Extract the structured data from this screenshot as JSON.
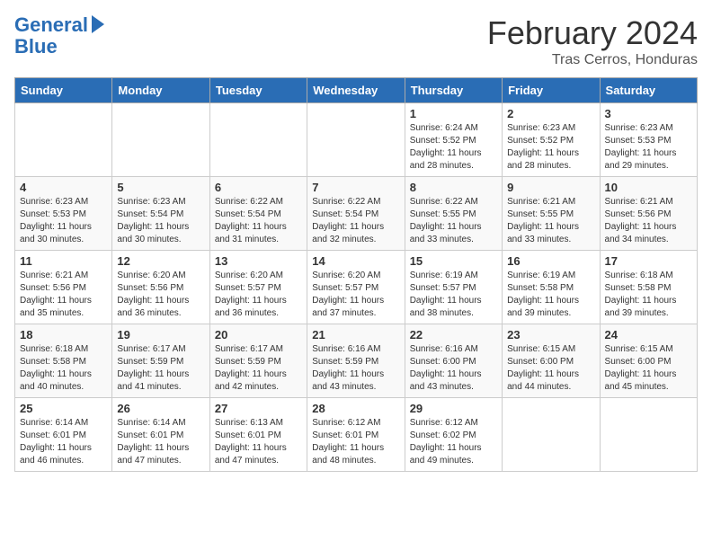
{
  "header": {
    "logo_line1": "General",
    "logo_line2": "Blue",
    "month_year": "February 2024",
    "location": "Tras Cerros, Honduras"
  },
  "days_of_week": [
    "Sunday",
    "Monday",
    "Tuesday",
    "Wednesday",
    "Thursday",
    "Friday",
    "Saturday"
  ],
  "weeks": [
    [
      {
        "day": "",
        "info": ""
      },
      {
        "day": "",
        "info": ""
      },
      {
        "day": "",
        "info": ""
      },
      {
        "day": "",
        "info": ""
      },
      {
        "day": "1",
        "info": "Sunrise: 6:24 AM\nSunset: 5:52 PM\nDaylight: 11 hours\nand 28 minutes."
      },
      {
        "day": "2",
        "info": "Sunrise: 6:23 AM\nSunset: 5:52 PM\nDaylight: 11 hours\nand 28 minutes."
      },
      {
        "day": "3",
        "info": "Sunrise: 6:23 AM\nSunset: 5:53 PM\nDaylight: 11 hours\nand 29 minutes."
      }
    ],
    [
      {
        "day": "4",
        "info": "Sunrise: 6:23 AM\nSunset: 5:53 PM\nDaylight: 11 hours\nand 30 minutes."
      },
      {
        "day": "5",
        "info": "Sunrise: 6:23 AM\nSunset: 5:54 PM\nDaylight: 11 hours\nand 30 minutes."
      },
      {
        "day": "6",
        "info": "Sunrise: 6:22 AM\nSunset: 5:54 PM\nDaylight: 11 hours\nand 31 minutes."
      },
      {
        "day": "7",
        "info": "Sunrise: 6:22 AM\nSunset: 5:54 PM\nDaylight: 11 hours\nand 32 minutes."
      },
      {
        "day": "8",
        "info": "Sunrise: 6:22 AM\nSunset: 5:55 PM\nDaylight: 11 hours\nand 33 minutes."
      },
      {
        "day": "9",
        "info": "Sunrise: 6:21 AM\nSunset: 5:55 PM\nDaylight: 11 hours\nand 33 minutes."
      },
      {
        "day": "10",
        "info": "Sunrise: 6:21 AM\nSunset: 5:56 PM\nDaylight: 11 hours\nand 34 minutes."
      }
    ],
    [
      {
        "day": "11",
        "info": "Sunrise: 6:21 AM\nSunset: 5:56 PM\nDaylight: 11 hours\nand 35 minutes."
      },
      {
        "day": "12",
        "info": "Sunrise: 6:20 AM\nSunset: 5:56 PM\nDaylight: 11 hours\nand 36 minutes."
      },
      {
        "day": "13",
        "info": "Sunrise: 6:20 AM\nSunset: 5:57 PM\nDaylight: 11 hours\nand 36 minutes."
      },
      {
        "day": "14",
        "info": "Sunrise: 6:20 AM\nSunset: 5:57 PM\nDaylight: 11 hours\nand 37 minutes."
      },
      {
        "day": "15",
        "info": "Sunrise: 6:19 AM\nSunset: 5:57 PM\nDaylight: 11 hours\nand 38 minutes."
      },
      {
        "day": "16",
        "info": "Sunrise: 6:19 AM\nSunset: 5:58 PM\nDaylight: 11 hours\nand 39 minutes."
      },
      {
        "day": "17",
        "info": "Sunrise: 6:18 AM\nSunset: 5:58 PM\nDaylight: 11 hours\nand 39 minutes."
      }
    ],
    [
      {
        "day": "18",
        "info": "Sunrise: 6:18 AM\nSunset: 5:58 PM\nDaylight: 11 hours\nand 40 minutes."
      },
      {
        "day": "19",
        "info": "Sunrise: 6:17 AM\nSunset: 5:59 PM\nDaylight: 11 hours\nand 41 minutes."
      },
      {
        "day": "20",
        "info": "Sunrise: 6:17 AM\nSunset: 5:59 PM\nDaylight: 11 hours\nand 42 minutes."
      },
      {
        "day": "21",
        "info": "Sunrise: 6:16 AM\nSunset: 5:59 PM\nDaylight: 11 hours\nand 43 minutes."
      },
      {
        "day": "22",
        "info": "Sunrise: 6:16 AM\nSunset: 6:00 PM\nDaylight: 11 hours\nand 43 minutes."
      },
      {
        "day": "23",
        "info": "Sunrise: 6:15 AM\nSunset: 6:00 PM\nDaylight: 11 hours\nand 44 minutes."
      },
      {
        "day": "24",
        "info": "Sunrise: 6:15 AM\nSunset: 6:00 PM\nDaylight: 11 hours\nand 45 minutes."
      }
    ],
    [
      {
        "day": "25",
        "info": "Sunrise: 6:14 AM\nSunset: 6:01 PM\nDaylight: 11 hours\nand 46 minutes."
      },
      {
        "day": "26",
        "info": "Sunrise: 6:14 AM\nSunset: 6:01 PM\nDaylight: 11 hours\nand 47 minutes."
      },
      {
        "day": "27",
        "info": "Sunrise: 6:13 AM\nSunset: 6:01 PM\nDaylight: 11 hours\nand 47 minutes."
      },
      {
        "day": "28",
        "info": "Sunrise: 6:12 AM\nSunset: 6:01 PM\nDaylight: 11 hours\nand 48 minutes."
      },
      {
        "day": "29",
        "info": "Sunrise: 6:12 AM\nSunset: 6:02 PM\nDaylight: 11 hours\nand 49 minutes."
      },
      {
        "day": "",
        "info": ""
      },
      {
        "day": "",
        "info": ""
      }
    ]
  ]
}
